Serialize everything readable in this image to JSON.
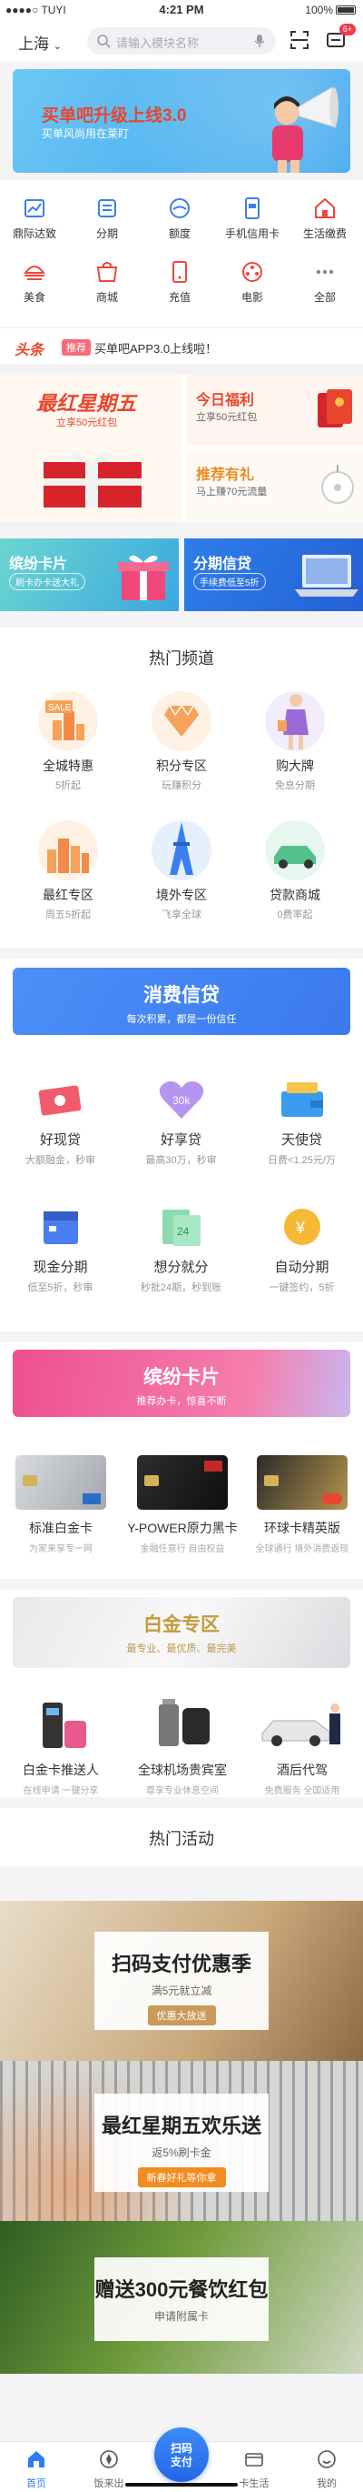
{
  "status": {
    "carrier": "●●●●○ TUYI",
    "time": "4:21 PM",
    "battery": "100%"
  },
  "header": {
    "city": "上海",
    "search_placeholder": "请输入模块名称",
    "message_badge": "6+"
  },
  "banner": {
    "title": "买单吧升级上线3.0",
    "subtitle": "买单风尚用在莱盯"
  },
  "categories": [
    {
      "label": "鼎际达致",
      "icon": "chart-icon",
      "color": "#3a7ef0"
    },
    {
      "label": "分期",
      "icon": "installment-icon",
      "color": "#3a7ef0"
    },
    {
      "label": "额度",
      "icon": "credit-limit-icon",
      "color": "#3a7ef0"
    },
    {
      "label": "手机信用卡",
      "icon": "phone-card-icon",
      "color": "#3a7ef0"
    },
    {
      "label": "生活缴费",
      "icon": "house-icon",
      "color": "#f0463a"
    },
    {
      "label": "美食",
      "icon": "food-icon",
      "color": "#f0463a"
    },
    {
      "label": "商城",
      "icon": "shop-icon",
      "color": "#f0463a"
    },
    {
      "label": "充值",
      "icon": "recharge-icon",
      "color": "#f0463a"
    },
    {
      "label": "电影",
      "icon": "movie-icon",
      "color": "#f0463a"
    },
    {
      "label": "全部",
      "icon": "more-icon",
      "color": "#888888"
    }
  ],
  "news": {
    "head": "头条",
    "tag": "推荐",
    "text": "买单吧APP3.0上线啦！"
  },
  "promo": {
    "left_title": "最红星期五",
    "left_sub": "立享50元红包",
    "right_top_title": "今日福利",
    "right_top_sub": "立享50元红包",
    "right_bottom_title": "推荐有礼",
    "right_bottom_sub": "马上赚70元流量"
  },
  "card_row": [
    {
      "title": "缤纷卡片",
      "sub": "刷卡办卡送大礼"
    },
    {
      "title": "分期信贷",
      "sub": "手续费低至5折"
    }
  ],
  "hot_title": "热门频道",
  "hot": [
    {
      "name": "全城特惠",
      "desc": "5折起"
    },
    {
      "name": "积分专区",
      "desc": "玩赚积分"
    },
    {
      "name": "购大牌",
      "desc": "免息分期"
    },
    {
      "name": "最红专区",
      "desc": "周五5折起"
    },
    {
      "name": "境外专区",
      "desc": "飞享全球"
    },
    {
      "name": "贷款商城",
      "desc": "0费率起"
    }
  ],
  "loan_banner": {
    "title": "消费信贷",
    "sub": "每次积累，都是一份信任"
  },
  "loans": [
    {
      "name": "好现贷",
      "desc": "大额融金，秒审"
    },
    {
      "name": "好享贷",
      "desc": "最高30万，秒审"
    },
    {
      "name": "天使贷",
      "desc": "日费<1.25元/万"
    },
    {
      "name": "现金分期",
      "desc": "低至5折，秒审"
    },
    {
      "name": "想分就分",
      "desc": "秒批24期，秒到账"
    },
    {
      "name": "自动分期",
      "desc": "一键签约，5折"
    }
  ],
  "cards_banner": {
    "title": "缤纷卡片",
    "sub": "推荐办卡，惊喜不断"
  },
  "credit_cards": [
    {
      "name": "标准白金卡",
      "desc": "为家来享专一网"
    },
    {
      "name": "Y-POWER原力黑卡",
      "desc": "金融任意行 自由权益"
    },
    {
      "name": "环球卡精英版",
      "desc": "全球通行 境外消费返现"
    }
  ],
  "platinum_banner": {
    "title": "白金专区",
    "sub": "最专业、最优质、最完美"
  },
  "platinum": [
    {
      "name": "白金卡推送人",
      "desc": "在线申请 一键分享"
    },
    {
      "name": "全球机场贵宾室",
      "desc": "尊享专业休息空间"
    },
    {
      "name": "酒后代驾",
      "desc": "免费服务 全国适用"
    }
  ],
  "activity_title": "热门活动",
  "activities": [
    {
      "title": "扫码支付优惠季",
      "sub": "满5元就立减",
      "tag": "优惠大放送"
    },
    {
      "title": "最红星期五欢乐送",
      "sub": "返5%刷卡金",
      "tag": "新春好礼等你拿"
    },
    {
      "title": "赠送300元餐饮红包",
      "sub": "申请附属卡",
      "tag": ""
    }
  ],
  "tabs": [
    {
      "label": "首页",
      "icon": "home-icon"
    },
    {
      "label": "饭来出",
      "icon": "compass-icon"
    },
    {
      "label": "扫码\n支付",
      "icon": "scan-icon"
    },
    {
      "label": "卡生活",
      "icon": "card-life-icon"
    },
    {
      "label": "我的",
      "icon": "profile-icon"
    }
  ],
  "colors": {
    "accent": "#2f7bf6",
    "red": "#e8462e",
    "pink": "#ee4f8f"
  }
}
